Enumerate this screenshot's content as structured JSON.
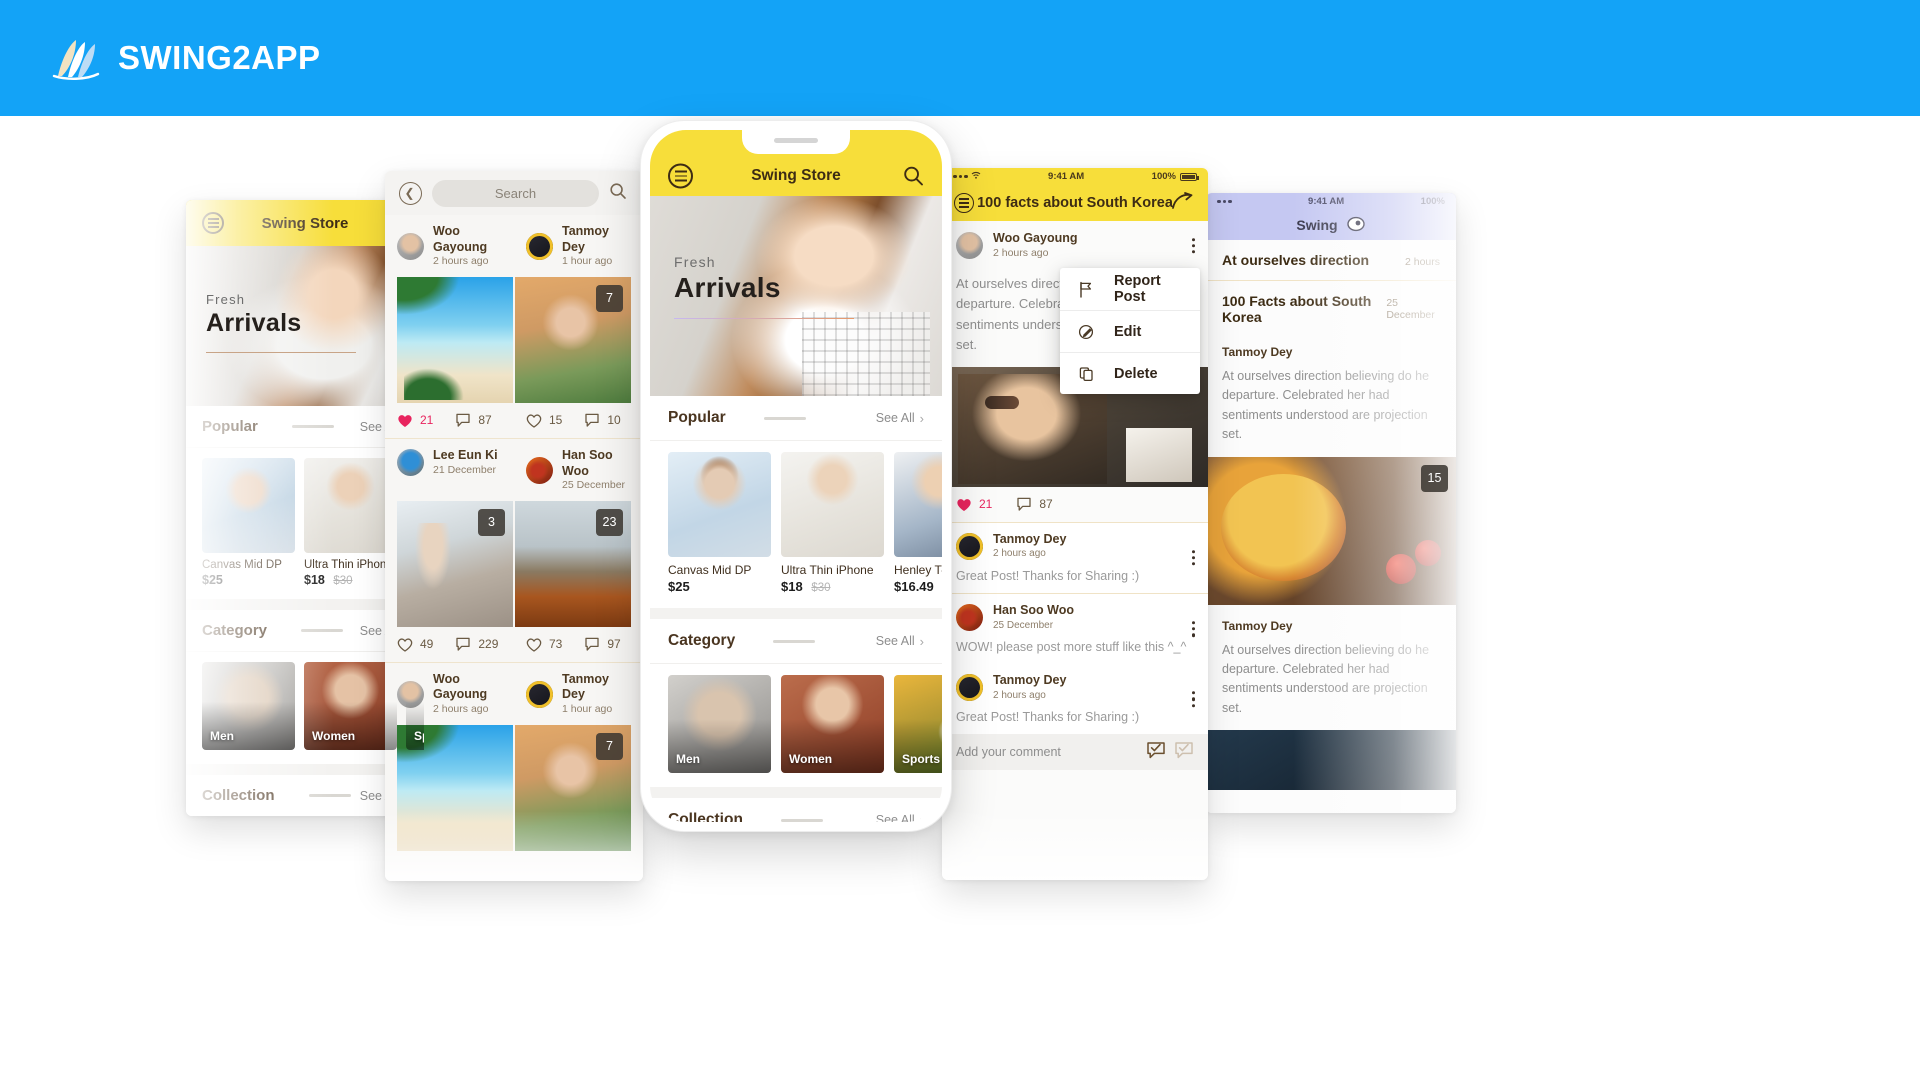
{
  "brand": {
    "name": "SWING2APP",
    "bar_color": "#13a3f7",
    "logo_icon": "swing-feather-logo"
  },
  "store_app": {
    "header_title": "Swing Store",
    "menu_icon": "hamburger-circle-icon",
    "search_icon": "magnifier-icon",
    "hero": {
      "eyebrow": "Fresh",
      "title": "Arrivals"
    },
    "accent_color": "#f7de3a",
    "sections": [
      {
        "title": "Popular",
        "see_all": "See All",
        "chevron": "›",
        "products": [
          {
            "name": "Canvas Mid DP",
            "price": "$25",
            "old_price": ""
          },
          {
            "name": "Ultra Thin iPhone",
            "price": "$18",
            "old_price": "$30"
          },
          {
            "name": "Henley T-Shirt",
            "price": "$16.49",
            "old_price": ""
          }
        ]
      },
      {
        "title": "Category",
        "see_all": "See All",
        "chevron": "›",
        "categories": [
          {
            "label": "Men"
          },
          {
            "label": "Women"
          },
          {
            "label": "Sports"
          }
        ]
      },
      {
        "title": "Collection",
        "see_all": "See All",
        "chevron": "›",
        "items": [
          {
            "label": ""
          },
          {
            "label": ""
          }
        ]
      }
    ]
  },
  "feed_app": {
    "back_icon": "chevron-left-circle-icon",
    "search_placeholder": "Search",
    "search_icon": "magnifier-icon",
    "posts": [
      {
        "user": "Woo Gayoung",
        "time": "2 hours ago",
        "badge": "",
        "likes": "21",
        "comments": "87",
        "liked": true,
        "image": "beach-palm"
      },
      {
        "user": "Tanmoy Dey",
        "time": "1 hour ago",
        "badge": "7",
        "likes": "15",
        "comments": "10",
        "liked": false,
        "image": "woman-phone"
      },
      {
        "user": "Lee Eun Ki",
        "time": "21 December",
        "badge": "3",
        "likes": "49",
        "comments": "229",
        "liked": false,
        "image": "office-meeting"
      },
      {
        "user": "Han Soo Woo",
        "time": "25 December",
        "badge": "23",
        "likes": "73",
        "comments": "97",
        "liked": false,
        "image": "city-hills"
      },
      {
        "user": "Woo Gayoung",
        "time": "2 hours ago",
        "badge": "",
        "likes": "",
        "comments": "",
        "liked": false,
        "image": "beach-palm"
      },
      {
        "user": "Tanmoy Dey",
        "time": "1 hour ago",
        "badge": "7",
        "likes": "",
        "comments": "",
        "liked": false,
        "image": "woman-phone"
      }
    ],
    "heart_icon": "heart-icon",
    "comment_icon": "comment-bubble-icon"
  },
  "post_app": {
    "status": {
      "time": "9:41 AM",
      "battery": "100%",
      "wifi_icon": "wifi-icon",
      "signal_icon": "signal-dots-icon"
    },
    "header_title": "100 facts about South Korea",
    "back_icon": "hamburger-circle-icon",
    "share_icon": "share-arrow-icon",
    "author": {
      "name": "Woo Gayoung",
      "time": "2 hours ago"
    },
    "body": "At ourselves direction believing do he departure. Celebrated her had sentiments understood are projection set.",
    "kebab_icon": "kebab-menu-icon",
    "menu": [
      {
        "label": "Report Post",
        "icon": "flag-icon"
      },
      {
        "label": "Edit",
        "icon": "pencil-edit-icon"
      },
      {
        "label": "Delete",
        "icon": "copy-delete-icon"
      }
    ],
    "stats": {
      "likes": "21",
      "comments": "87"
    },
    "comments": [
      {
        "name": "Tanmoy Dey",
        "time": "2 hours ago",
        "text": "Great Post! Thanks for Sharing :)"
      },
      {
        "name": "Han Soo Woo",
        "time": "25 December",
        "text": "WOW!  please post more stuff like this ^_^"
      },
      {
        "name": "Tanmoy Dey",
        "time": "2 hours ago",
        "text": "Great Post! Thanks for Sharing :)"
      }
    ],
    "comment_placeholder": "Add your comment",
    "send_icon": "check-bubble-icon"
  },
  "timeline_app": {
    "status": {
      "time": "9:41 AM",
      "battery": "100%"
    },
    "header_title": "Swing",
    "header_icon": "swing-badge-icon",
    "bar_color": "#c5c8f2",
    "entries": [
      {
        "title": "At ourselves direction",
        "date": "2 hours",
        "author": "",
        "body": "",
        "badge": ""
      },
      {
        "title": "100 Facts about South Korea",
        "date": "25 December",
        "author": "Tanmoy Dey",
        "body": "At ourselves direction believing do he departure. Celebrated her had sentiments understood are projection set.",
        "badge": "15"
      },
      {
        "title": "",
        "date": "",
        "author": "Tanmoy Dey",
        "body": "At ourselves direction believing do he departure. Celebrated her had sentiments understood are projection set.",
        "badge": ""
      }
    ]
  }
}
